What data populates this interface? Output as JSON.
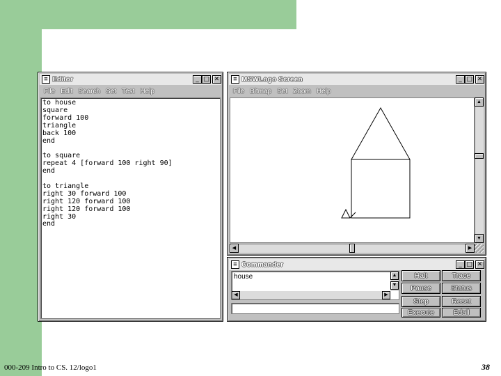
{
  "colors": {
    "slide_accent": "#99cc99",
    "window_face": "#c0c0c0"
  },
  "editor": {
    "title": "Editor",
    "menu": [
      "File",
      "Edit",
      "Search",
      "Set",
      "Test",
      "Help"
    ],
    "lines": [
      "to house",
      "square",
      "forward 100",
      "triangle",
      "back 100",
      "end",
      "",
      "to square",
      "repeat 4 [forward 100 right 90]",
      "end",
      "",
      "to triangle",
      "right 30 forward 100",
      "right 120 forward 100",
      "right 120 forward 100",
      "right 30",
      "end"
    ]
  },
  "screen": {
    "title": "MSWLogo Screen",
    "menu": [
      "File",
      "Bitmap",
      "Set",
      "Zoom",
      "Help"
    ],
    "drawing": "house"
  },
  "commander": {
    "title": "Commander",
    "history": "house",
    "input": "",
    "buttons": {
      "halt": "Halt",
      "trace": "Trace",
      "pause": "Pause",
      "status": "Status",
      "step": "Step",
      "reset": "Reset",
      "execute": "Execute",
      "edall": "Edall"
    }
  },
  "window_buttons": {
    "minimize": "_",
    "maximize": "□",
    "close": "✕"
  },
  "footer": {
    "course": "000-209 Intro to CS. 12/logo1",
    "page": "38"
  }
}
